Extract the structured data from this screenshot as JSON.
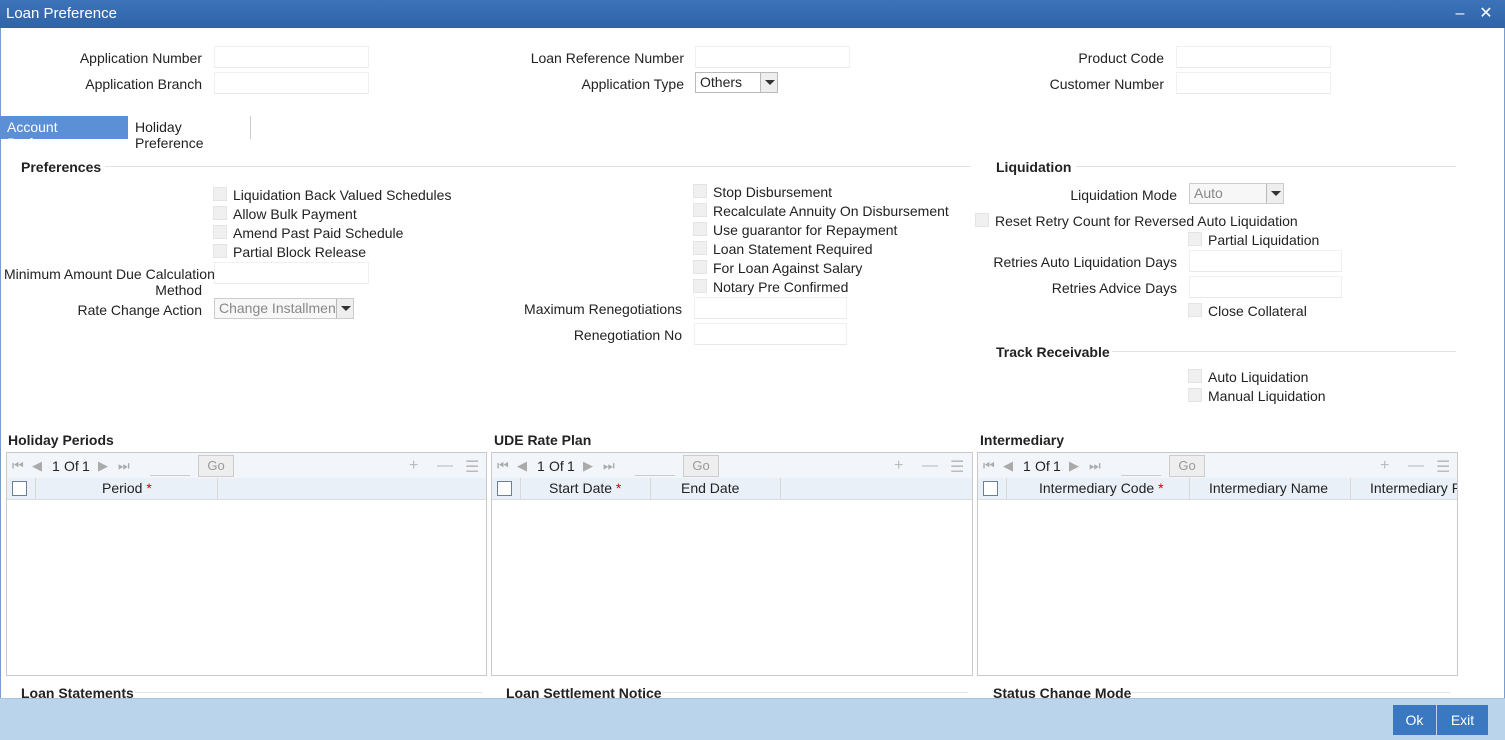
{
  "window": {
    "title": "Loan Preference",
    "min_icon": "minimize-icon",
    "close_icon": "close-icon"
  },
  "header": {
    "application_number_label": "Application Number",
    "application_branch_label": "Application Branch",
    "loan_ref_label": "Loan Reference Number",
    "application_type_label": "Application Type",
    "application_type_value": "Others",
    "product_code_label": "Product Code",
    "customer_number_label": "Customer Number"
  },
  "tabs": [
    {
      "label": "Account Preference",
      "active": true
    },
    {
      "label": "Holiday Preference",
      "active": false
    }
  ],
  "preferences": {
    "title": "Preferences",
    "checks_left": [
      "Liquidation Back Valued Schedules",
      "Allow Bulk Payment",
      "Amend Past Paid Schedule",
      "Partial Block Release"
    ],
    "min_amount_label_1": "Minimum Amount Due Calculation",
    "min_amount_label_2": "Method",
    "rate_change_label": "Rate Change Action",
    "rate_change_value": "Change Installment",
    "checks_mid": [
      "Stop Disbursement",
      "Recalculate Annuity On Disbursement",
      "Use guarantor for Repayment",
      "Loan Statement Required",
      "For Loan Against Salary",
      "Notary Pre Confirmed"
    ],
    "max_reneg_label": "Maximum Renegotiations",
    "reneg_no_label": "Renegotiation No"
  },
  "liquidation": {
    "title": "Liquidation",
    "mode_label": "Liquidation Mode",
    "mode_value": "Auto",
    "reset_retry_label": "Reset Retry Count for Reversed Auto Liquidation",
    "partial_label": "Partial Liquidation",
    "retries_auto_label": "Retries Auto Liquidation Days",
    "retries_advice_label": "Retries Advice Days",
    "close_collateral_label": "Close Collateral"
  },
  "track_receivable": {
    "title": "Track Receivable",
    "auto_label": "Auto Liquidation",
    "manual_label": "Manual Liquidation"
  },
  "grids": {
    "holiday": {
      "title": "Holiday Periods",
      "page": "1",
      "of": "Of",
      "total": "1",
      "go": "Go",
      "cols": [
        "Period"
      ]
    },
    "ude": {
      "title": "UDE Rate Plan",
      "page": "1",
      "of": "Of",
      "total": "1",
      "go": "Go",
      "cols": [
        "Start Date",
        "End Date"
      ]
    },
    "intermediary": {
      "title": "Intermediary",
      "page": "1",
      "of": "Of",
      "total": "1",
      "go": "Go",
      "cols": [
        "Intermediary Code",
        "Intermediary Name",
        "Intermediary Ra"
      ]
    }
  },
  "bottom_sections": [
    "Loan Statements",
    "Loan Settlement Notice",
    "Status Change Mode"
  ],
  "footer": {
    "ok": "Ok",
    "exit": "Exit"
  },
  "required_mark": "*"
}
